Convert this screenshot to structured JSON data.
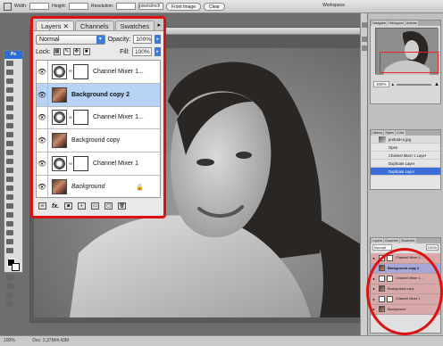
{
  "options_bar": {
    "width_label": "Width:",
    "height_label": "Height:",
    "resolution_label": "Resolution:",
    "resolution_unit": "pixels/inch",
    "front_image_button": "Front Image",
    "clear_button": "Clear",
    "workspace_label": "Workspace"
  },
  "toolbox": {
    "logo": "Ps"
  },
  "layers_panel": {
    "tabs": [
      "Layers",
      "Channels",
      "Swatches"
    ],
    "blend_mode": "Normal",
    "opacity_label": "Opacity:",
    "opacity_value": "100%",
    "lock_label": "Lock:",
    "fill_label": "Fill:",
    "fill_value": "100%",
    "layers": [
      {
        "name": "Channel Mixer 1...",
        "kind": "adjustment",
        "selected": false,
        "italic": false,
        "locked": false
      },
      {
        "name": "Background copy 2",
        "kind": "pixel",
        "selected": true,
        "italic": false,
        "locked": false
      },
      {
        "name": "Channel Mixer 1...",
        "kind": "adjustment",
        "selected": false,
        "italic": false,
        "locked": false
      },
      {
        "name": "Background copy",
        "kind": "pixel",
        "selected": false,
        "italic": false,
        "locked": false
      },
      {
        "name": "Channel Mixer 1",
        "kind": "adjustment",
        "selected": false,
        "italic": false,
        "locked": false
      },
      {
        "name": "Background",
        "kind": "pixel",
        "selected": false,
        "italic": true,
        "locked": true
      }
    ],
    "footer_fx": "fx."
  },
  "navigator": {
    "tabs": [
      "Navigator",
      "Histogram",
      "Actions"
    ],
    "zoom": "100%"
  },
  "history": {
    "tabs": [
      "History",
      "Styles",
      "Color"
    ],
    "snapshot": "portrait-ru.jpg",
    "items": [
      "Open",
      "Channel Mixer 1 Layer",
      "Duplicate Layer",
      "Duplicate Layer"
    ]
  },
  "mini_layers": {
    "tabs": [
      "Layers",
      "Channels",
      "Swatches"
    ],
    "blend_mode": "Normal",
    "opacity": "100%",
    "layers": [
      "Channel Mixer 1...",
      "Background copy 2",
      "Channel Mixer 1...",
      "Background copy",
      "Channel Mixer 1",
      "Background"
    ]
  },
  "status": {
    "zoom": "100%",
    "doc": "Doc: 2,37M/4,43M"
  }
}
